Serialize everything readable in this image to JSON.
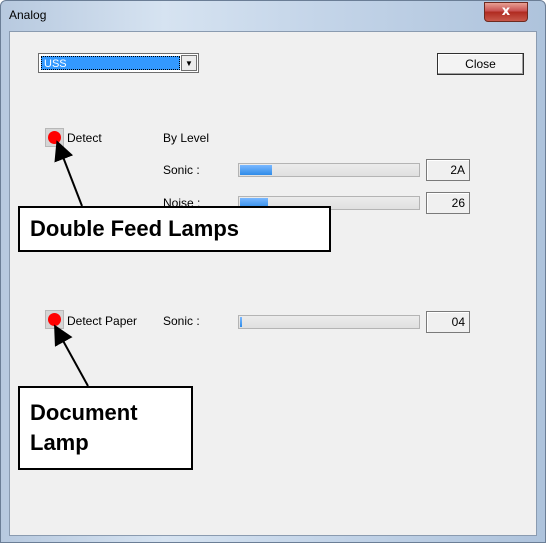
{
  "window": {
    "title": "Analog",
    "close_glyph": "x"
  },
  "toolbar": {
    "combo_value": "USS",
    "combo_arrow": "▼",
    "close_label": "Close"
  },
  "double_feed": {
    "lamp_label": "Detect",
    "mode_label": "By Level",
    "rows": [
      {
        "label": "Sonic :",
        "value": "2A",
        "level_percent": 18
      },
      {
        "label": "Noise :",
        "value": "26",
        "level_percent": 16
      }
    ]
  },
  "document": {
    "lamp_label": "Detect Paper",
    "row": {
      "label": "Sonic :",
      "value": "04",
      "level_percent": 1
    }
  },
  "callouts": {
    "double_feed": "Double Feed Lamps",
    "document_line1": "Document",
    "document_line2": "Lamp"
  },
  "colors": {
    "lamp_on": "#ff0000",
    "selection": "#3399ff",
    "bar_fill": "#2f8ce8"
  }
}
